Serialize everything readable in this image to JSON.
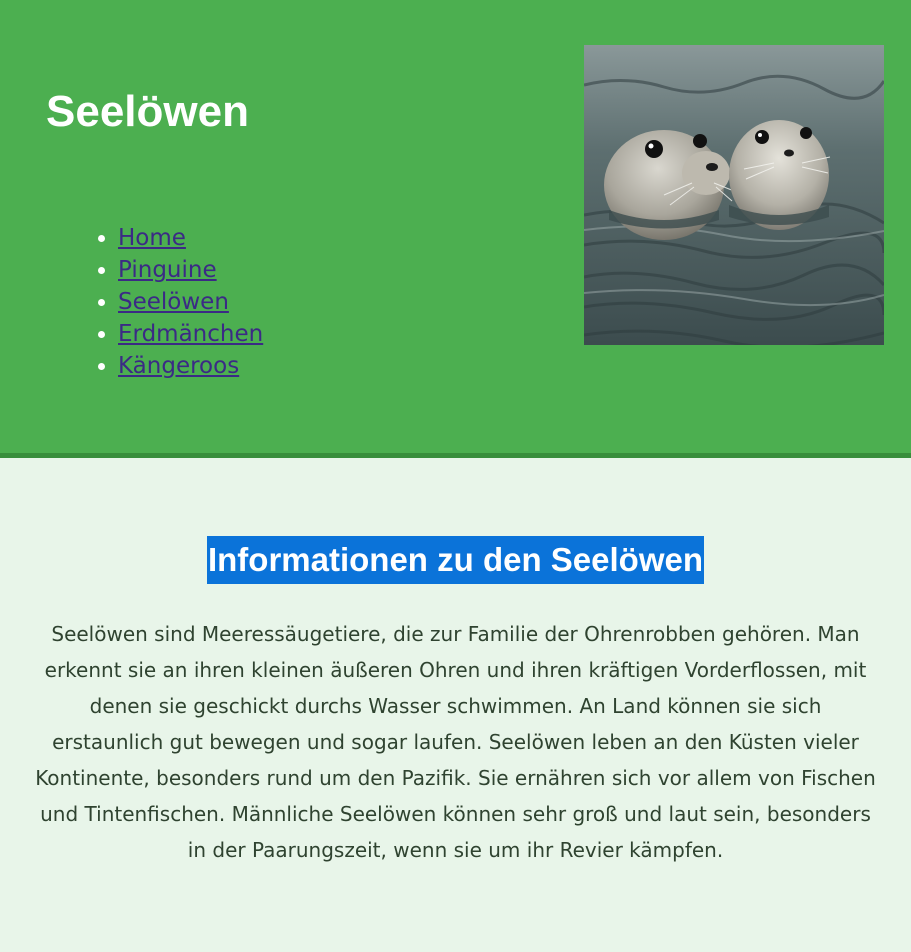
{
  "header": {
    "title": "Seelöwen",
    "nav": [
      {
        "label": "Home"
      },
      {
        "label": "Pinguine"
      },
      {
        "label": "Seelöwen"
      },
      {
        "label": "Erdmänchen"
      },
      {
        "label": "Kängeroos"
      }
    ],
    "image": {
      "icon": "seal-photo",
      "subject": "two seals swimming in the sea"
    }
  },
  "main": {
    "heading": "Informationen zu den Seelöwen",
    "paragraph": "Seelöwen sind Meeressäugetiere, die zur Familie der Ohrenrobben gehören. Man erkennt sie an ihren kleinen äußeren Ohren und ihren kräftigen Vorderflossen, mit denen sie geschickt durchs Wasser schwimmen. An Land können sie sich erstaunlich gut bewegen und sogar laufen. Seelöwen leben an den Küsten vieler Kontinente, besonders rund um den Pazifik. Sie ernähren sich vor allem von Fischen und Tintenfischen. Männliche Seelöwen können sehr groß und laut sein, besonders in der Paarungszeit, wenn sie um ihr Revier kämpfen."
  },
  "colors": {
    "header_bg": "#4caf50",
    "header_border": "#388e3c",
    "page_bg": "#e8f5e9",
    "link": "#3b2a85",
    "heading_highlight": "#0b73d9",
    "text": "#2f4330"
  }
}
